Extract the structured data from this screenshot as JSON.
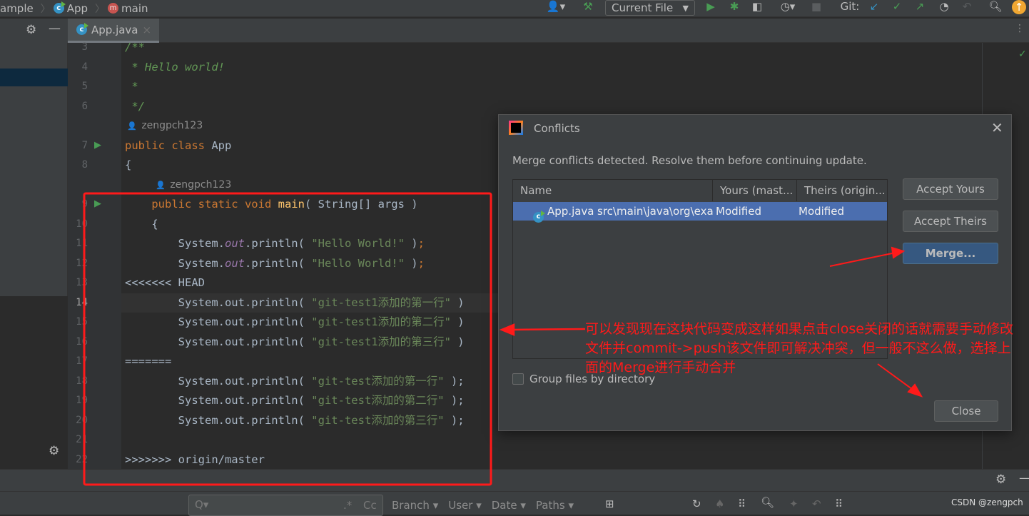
{
  "breadcrumb": {
    "items": [
      "ample",
      "App",
      "main"
    ]
  },
  "toolbar": {
    "run_config": "Current File",
    "git_label": "Git:"
  },
  "editor": {
    "tab": "App.java",
    "lines": [
      {
        "n": "3",
        "parts": [
          [
            "cm",
            "/**"
          ]
        ]
      },
      {
        "n": "4",
        "parts": [
          [
            "cm",
            " * Hello world!"
          ]
        ]
      },
      {
        "n": "5",
        "parts": [
          [
            "cm",
            " *"
          ]
        ]
      },
      {
        "n": "6",
        "parts": [
          [
            "cm",
            " */"
          ]
        ]
      },
      {
        "n": "",
        "author": "zengpch123",
        "indent": 0
      },
      {
        "n": "7",
        "run": true,
        "parts": [
          [
            "kw",
            "public class "
          ],
          [
            "tx",
            "App"
          ]
        ]
      },
      {
        "n": "8",
        "parts": [
          [
            "tx",
            "{"
          ]
        ]
      },
      {
        "n": "",
        "author": "zengpch123",
        "indent": 4
      },
      {
        "n": "9",
        "run": true,
        "parts": [
          [
            "tx",
            "    "
          ],
          [
            "kw",
            "public static void "
          ],
          [
            "fn",
            "main"
          ],
          [
            "tx",
            "( String[] args )"
          ]
        ]
      },
      {
        "n": "10",
        "parts": [
          [
            "tx",
            "    {"
          ]
        ]
      },
      {
        "n": "11",
        "parts": [
          [
            "tx",
            "        System."
          ],
          [
            "fld",
            "out"
          ],
          [
            "tx",
            ".println( "
          ],
          [
            "str",
            "\"Hello World!\""
          ],
          [
            "tx",
            " )"
          ],
          [
            "kw",
            ";"
          ]
        ]
      },
      {
        "n": "12",
        "parts": [
          [
            "tx",
            "        System."
          ],
          [
            "fld",
            "out"
          ],
          [
            "tx",
            ".println( "
          ],
          [
            "str",
            "\"Hello World!\""
          ],
          [
            "tx",
            " )"
          ],
          [
            "kw",
            ";"
          ]
        ]
      },
      {
        "n": "13",
        "parts": [
          [
            "tx",
            "<<<<<<< HEAD"
          ]
        ]
      },
      {
        "n": "14",
        "current": true,
        "parts": [
          [
            "tx",
            "        System.out.println( "
          ],
          [
            "str",
            "\"git-test1添加的第一行\""
          ],
          [
            "tx",
            " )"
          ]
        ]
      },
      {
        "n": "15",
        "parts": [
          [
            "tx",
            "        System.out.println( "
          ],
          [
            "str",
            "\"git-test1添加的第二行\""
          ],
          [
            "tx",
            " )"
          ]
        ]
      },
      {
        "n": "16",
        "parts": [
          [
            "tx",
            "        System.out.println( "
          ],
          [
            "str",
            "\"git-test1添加的第三行\""
          ],
          [
            "tx",
            " )"
          ]
        ]
      },
      {
        "n": "17",
        "parts": [
          [
            "tx",
            "======="
          ]
        ]
      },
      {
        "n": "18",
        "parts": [
          [
            "tx",
            "        System.out.println( "
          ],
          [
            "str",
            "\"git-test添加的第一行\""
          ],
          [
            "tx",
            " );"
          ]
        ]
      },
      {
        "n": "19",
        "parts": [
          [
            "tx",
            "        System.out.println( "
          ],
          [
            "str",
            "\"git-test添加的第二行\""
          ],
          [
            "tx",
            " );"
          ]
        ]
      },
      {
        "n": "20",
        "parts": [
          [
            "tx",
            "        System.out.println( "
          ],
          [
            "str",
            "\"git-test添加的第三行\""
          ],
          [
            "tx",
            " );"
          ]
        ]
      },
      {
        "n": "21",
        "parts": [
          [
            "tx",
            ""
          ]
        ]
      },
      {
        "n": "22",
        "parts": [
          [
            "tx",
            ">>>>>>> origin/master"
          ]
        ]
      }
    ]
  },
  "dialog": {
    "title": "Conflicts",
    "message": "Merge conflicts detected. Resolve them before continuing update.",
    "columns": [
      "Name",
      "Yours (mast...",
      "Theirs (origin..."
    ],
    "rows": [
      {
        "file": "App.java",
        "path": "src\\main\\java\\org\\exa",
        "yours": "Modified",
        "theirs": "Modified"
      }
    ],
    "group_checkbox": "Group files by directory",
    "group_checked": false,
    "accept_yours": "Accept Yours",
    "accept_theirs": "Accept Theirs",
    "merge": "Merge...",
    "close": "Close"
  },
  "annotation": "可以发现现在这块代码变成这样如果点击close关闭的话就需要手动修改文件并commit->push该文件即可解决冲突，但一般不这么做，选择上面的Merge进行手动合并",
  "gitlog": {
    "filters": [
      "Branch",
      "User",
      "Date",
      "Paths"
    ],
    "regex": ".*",
    "case": "Cc"
  },
  "watermark": "CSDN @zengpch",
  "colors": {
    "accent": "#365880",
    "annotation": "#ff1a1a",
    "selection": "#4b6eaf"
  }
}
